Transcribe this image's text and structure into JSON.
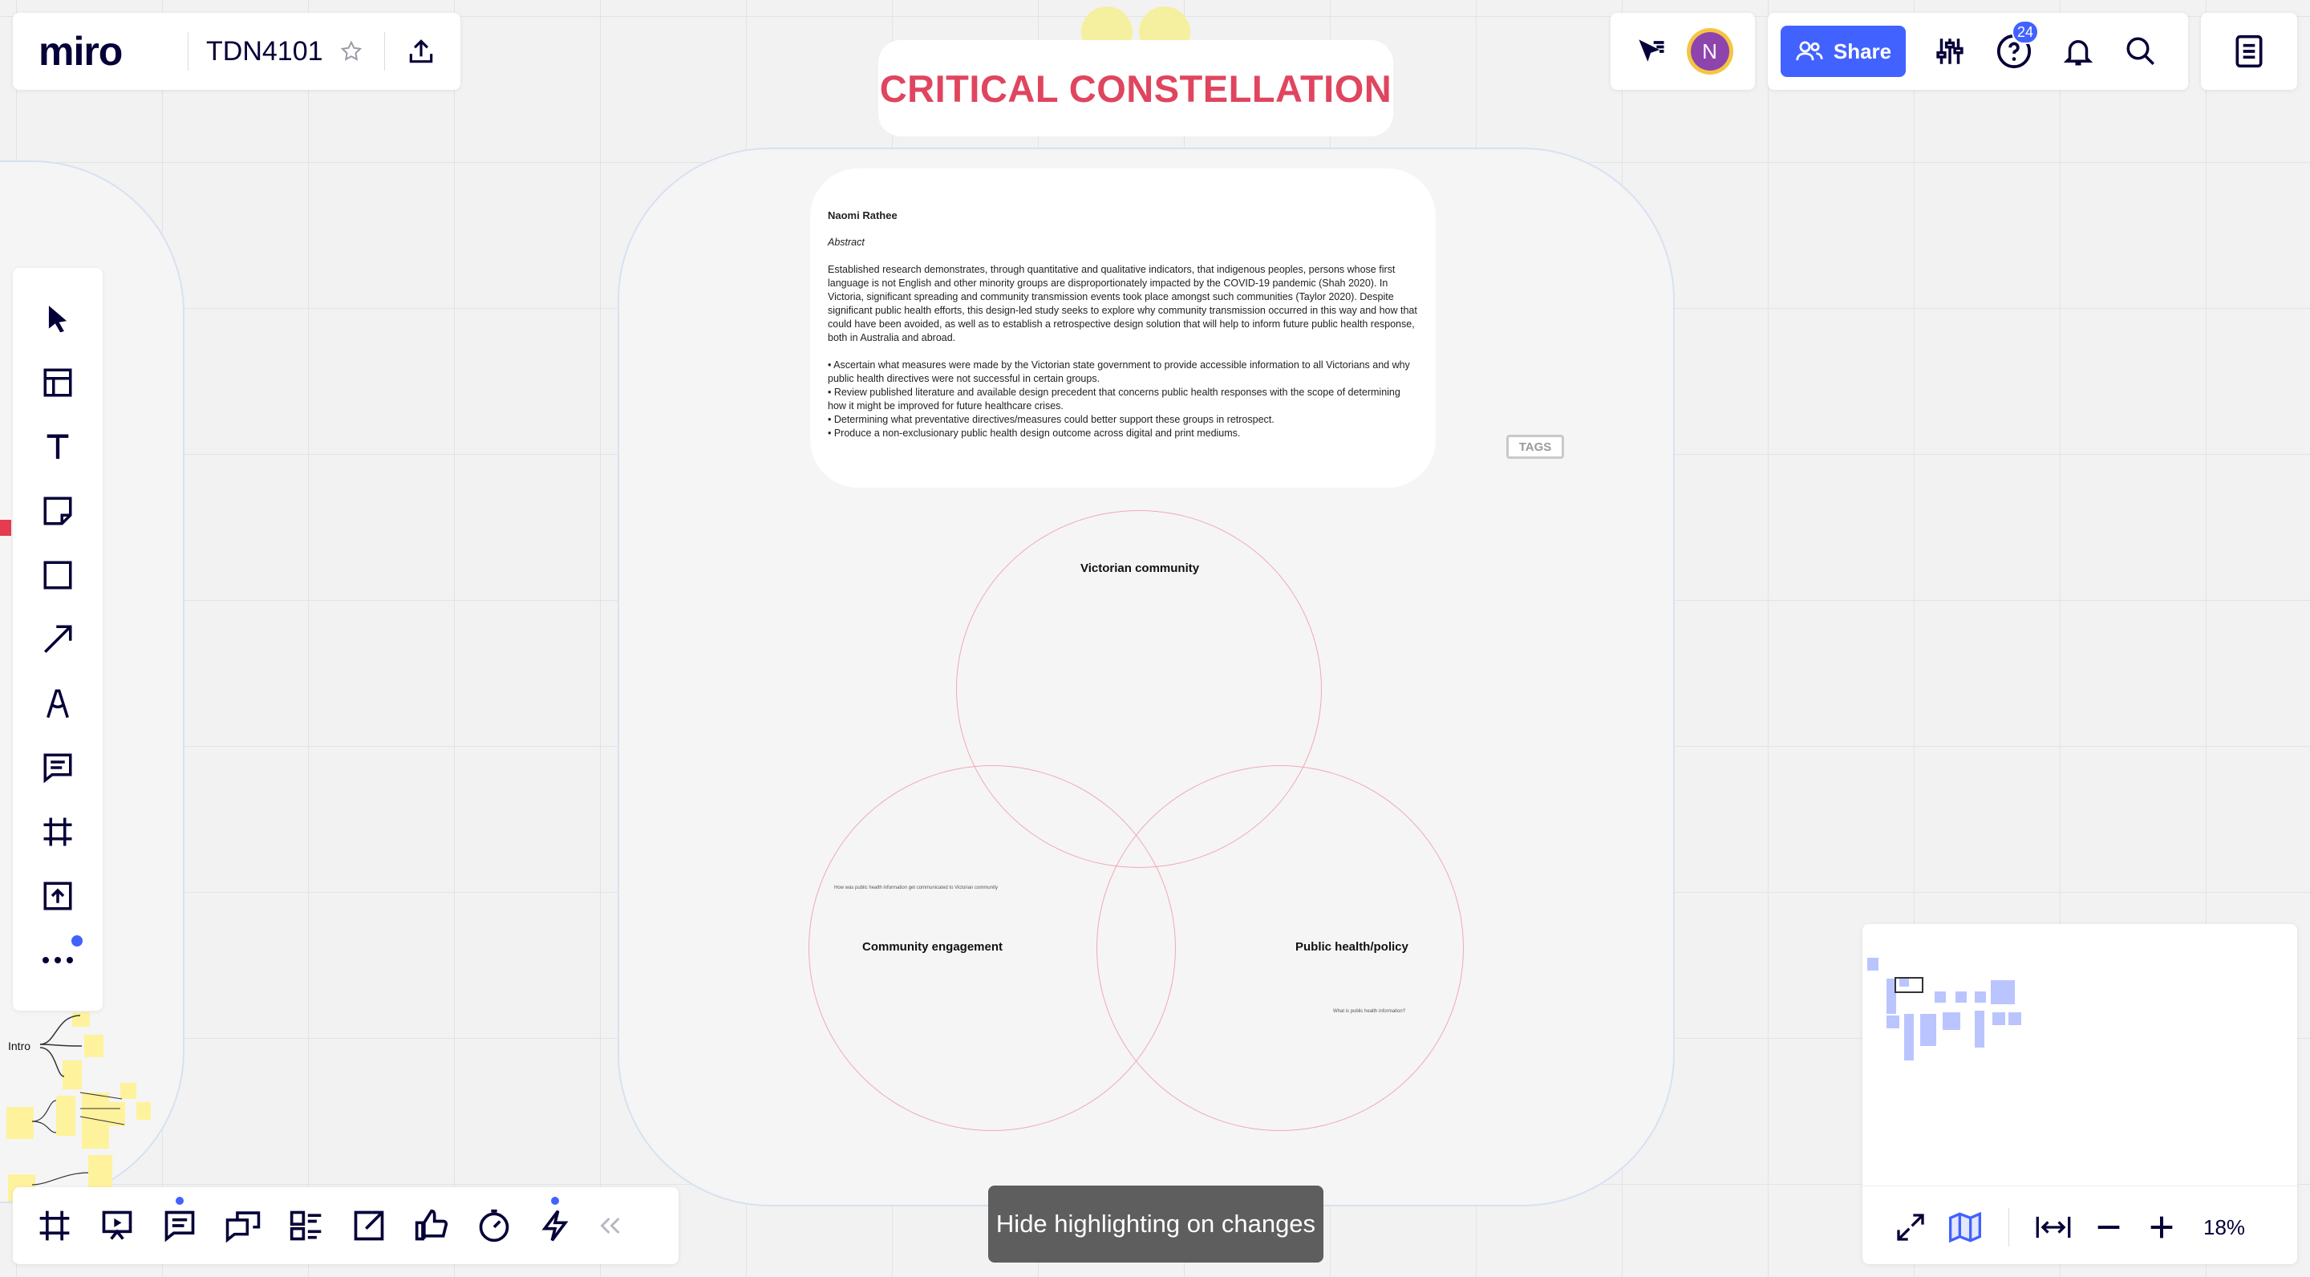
{
  "app": {
    "logo": "miro",
    "board_name": "TDN4101"
  },
  "header": {
    "share_label": "Share",
    "help_badge": "24",
    "avatar_initial": "N"
  },
  "colors": {
    "accent": "#4262ff",
    "title": "#e0455f",
    "avatar": "#8e44ad",
    "avatar_ring": "#f5c542",
    "sticky": "#fef29d"
  },
  "board": {
    "title": "CRITICAL CONSTELLATION",
    "author": "Naomi Rathee",
    "abstract_label": "Abstract",
    "abstract_paragraph": "Established research demonstrates, through quantitative and qualitative indicators, that indigenous peoples, persons whose first language is not English and other minority groups are disproportionately impacted by the COVID-19 pandemic (Shah 2020). In Victoria, significant spreading and community transmission events took place amongst such communities (Taylor 2020). Despite significant public health efforts, this design-led study seeks to explore why community transmission occurred in this way and how that could have been avoided, as well as to establish a retrospective design solution that will help to inform future public health response, both in Australia and abroad.",
    "bullets": [
      "• Ascertain what measures were made by the Victorian state government to provide accessible information to all Victorians and why public health directives were not successful in certain groups.",
      " • Review published literature and available design precedent that concerns public health responses with the scope of determining how it might be improved for future healthcare crises.",
      " • Determining what preventative directives/measures could better support these groups in retrospect.",
      " • Produce a non-exclusionary public health design outcome across digital and print mediums."
    ],
    "tags_label": "TAGS",
    "venn": {
      "top_label": "Victorian community",
      "left_label": "Community engagement",
      "right_label": "Public health/policy",
      "left_note": "How was public health information get communicated to Victorian community",
      "right_note": "What is public health information?"
    },
    "left_cluster": {
      "intro_label": "Intro"
    }
  },
  "toolbar_left": {
    "tools": [
      "select-icon",
      "templates-icon",
      "text-icon",
      "sticky-note-icon",
      "shape-icon",
      "connection-line-icon",
      "pen-icon",
      "comment-icon",
      "frame-icon",
      "upload-icon",
      "more-icon"
    ]
  },
  "toolbar_bottom": {
    "tools": [
      "frames-icon",
      "presentation-icon",
      "comments-icon",
      "chat-icon",
      "cards-icon",
      "share-screen-icon",
      "voting-icon",
      "timer-icon",
      "activity-icon",
      "collapse-icon"
    ]
  },
  "toast": {
    "text": "Hide highlighting on changes"
  },
  "zoom": {
    "level": "18%"
  }
}
